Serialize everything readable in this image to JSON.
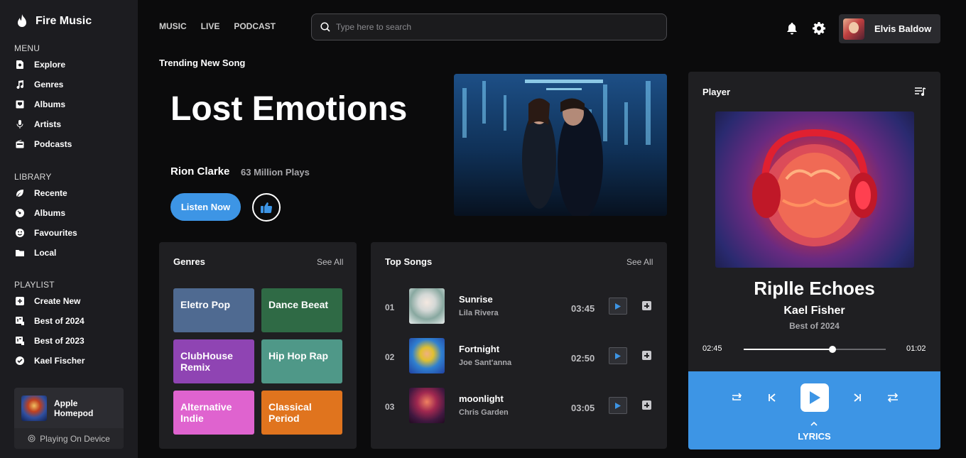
{
  "brand": {
    "name": "Fire Music"
  },
  "sidebar": {
    "menu_title": "MENU",
    "menu": [
      {
        "label": "Explore",
        "icon": "explore-icon"
      },
      {
        "label": "Genres",
        "icon": "music-note-icon"
      },
      {
        "label": "Albums",
        "icon": "album-icon"
      },
      {
        "label": "Artists",
        "icon": "microphone-icon"
      },
      {
        "label": "Podcasts",
        "icon": "radio-icon"
      }
    ],
    "library_title": "LIBRARY",
    "library": [
      {
        "label": "Recente",
        "icon": "leaf-icon"
      },
      {
        "label": "Albums",
        "icon": "disc-icon"
      },
      {
        "label": "Favourites",
        "icon": "smile-icon"
      },
      {
        "label": "Local",
        "icon": "folder-icon"
      }
    ],
    "playlist_title": "PLAYLIST",
    "playlist": [
      {
        "label": "Create New",
        "icon": "plus-box-icon"
      },
      {
        "label": "Best of 2024",
        "icon": "playlist-icon"
      },
      {
        "label": "Best of 2023",
        "icon": "playlist-icon"
      },
      {
        "label": "Kael Fischer",
        "icon": "check-circle-icon"
      }
    ],
    "device": {
      "name": "Apple Homepod",
      "status": "Playing On Device"
    }
  },
  "topnav": {
    "tabs": [
      "MUSIC",
      "LIVE",
      "PODCAST"
    ]
  },
  "search": {
    "placeholder": "Type here to search",
    "value": ""
  },
  "user": {
    "name": "Elvis Baldow"
  },
  "hero": {
    "section_title": "Trending New Song",
    "title": "Lost Emotions",
    "artist": "Rion Clarke",
    "plays": "63 Million Plays",
    "listen_label": "Listen Now"
  },
  "genres": {
    "title": "Genres",
    "see_all": "See All",
    "items": [
      {
        "label": "Eletro Pop",
        "color": "#4f6a91"
      },
      {
        "label": "Dance Beeat",
        "color": "#2f6a45"
      },
      {
        "label": "ClubHouse Remix",
        "color": "#8f44b3"
      },
      {
        "label": "Hip Hop Rap",
        "color": "#4f9888"
      },
      {
        "label": "Alternative Indie",
        "color": "#df63cf"
      },
      {
        "label": "Classical Period",
        "color": "#e0741e"
      }
    ]
  },
  "top_songs": {
    "title": "Top Songs",
    "see_all": "See All",
    "songs": [
      {
        "num": "01",
        "title": "Sunrise",
        "artist": "Lila Rivera",
        "duration": "03:45"
      },
      {
        "num": "02",
        "title": "Fortnight",
        "artist": "Joe Sant'anna",
        "duration": "02:50"
      },
      {
        "num": "03",
        "title": "moonlight",
        "artist": "Chris Garden",
        "duration": "03:05"
      }
    ]
  },
  "player": {
    "label": "Player",
    "track_title": "Riplle Echoes",
    "artist": "Kael Fisher",
    "album": "Best of 2024",
    "elapsed": "02:45",
    "remaining": "01:02",
    "progress": 0.625,
    "lyrics_label": "LYRICS"
  },
  "colors": {
    "accent": "#3d95e5",
    "sidebar_bg": "#1c1c20",
    "panel_bg": "#1f1f22"
  }
}
